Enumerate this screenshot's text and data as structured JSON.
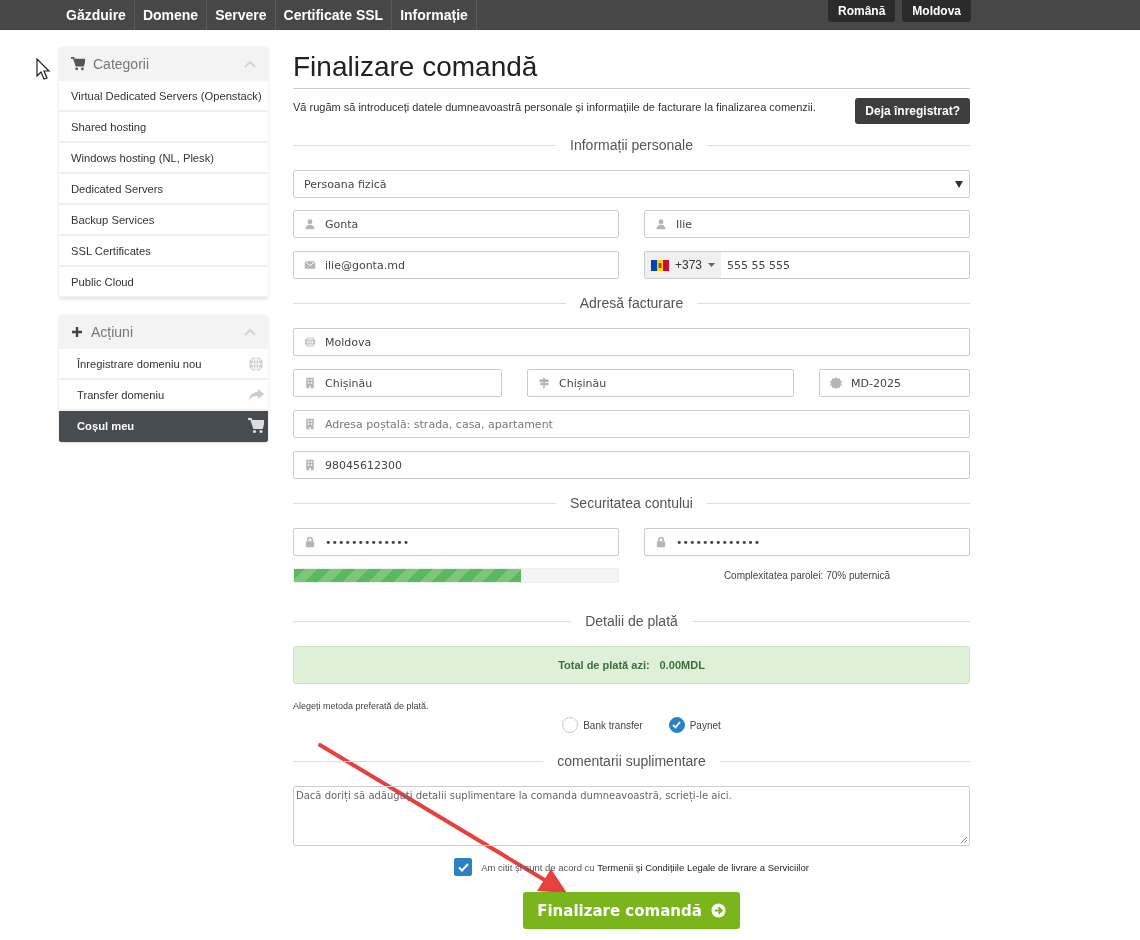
{
  "top_nav": {
    "links": [
      "Găzduire",
      "Domene",
      "Servere",
      "Certificate SSL",
      "Informație"
    ],
    "buttons": [
      "Română",
      "Moldova"
    ]
  },
  "sidebar": {
    "panels": [
      {
        "kind": "categories",
        "title": "Categorii",
        "expanded": true,
        "items": [
          {
            "label": "Virtual Dedicated Servers (Openstack)",
            "selected": false
          },
          {
            "label": "Shared hosting",
            "selected": false
          },
          {
            "label": "Windows hosting (NL, Plesk)",
            "selected": false
          },
          {
            "label": "Dedicated Servers",
            "selected": false
          },
          {
            "label": "Backup Services",
            "selected": false
          },
          {
            "label": "SSL Certificates",
            "selected": false
          },
          {
            "label": "Public Cloud",
            "selected": false
          }
        ]
      },
      {
        "kind": "actions",
        "title": "Acțiuni",
        "expanded": true,
        "items": [
          {
            "label": "Înregistrare domeniu nou",
            "kind": "globe",
            "selected": false
          },
          {
            "label": "Transfer domeniu",
            "kind": "share",
            "selected": false
          },
          {
            "label": "Coșul meu",
            "kind": "cart",
            "selected": true
          }
        ]
      }
    ]
  },
  "main": {
    "title": "Finalizare comandă",
    "intro": "Vă rugăm să introduceți datele dumneavoastră personale și informațiile de facturare la finalizarea comenzii.",
    "login_button": "Deja înregistrat?",
    "personal": {
      "heading": "Informații personale",
      "account_type": "Persoana fizică",
      "rows": [
        [
          {
            "kind": "user",
            "value": "Gonta"
          },
          {
            "kind": "user",
            "value": "Ilie"
          }
        ],
        [
          {
            "kind": "email",
            "value": "ilie@gonta.md"
          },
          {
            "kind": "phone",
            "code": "+373",
            "value": "555 55 555"
          }
        ]
      ]
    },
    "billing": {
      "heading": "Adresă facturare",
      "rows": [
        [
          {
            "kind": "globe",
            "value": "Moldova"
          }
        ],
        [
          {
            "kind": "building",
            "value": "Chișinău"
          },
          {
            "kind": "signpost",
            "value": "Chișinău"
          },
          {
            "kind": "seal",
            "value": "MD-2025"
          }
        ],
        [
          {
            "kind": "building",
            "placeholder": "Adresa poștală: strada, casa, apartament"
          }
        ],
        [
          {
            "kind": "office",
            "value": "98045612300"
          }
        ]
      ]
    },
    "security": {
      "heading": "Securitatea contului",
      "rows": [
        [
          {
            "kind": "lock",
            "value": "•••••••••••••"
          },
          {
            "kind": "lock",
            "value": "•••••••••••••"
          }
        ]
      ],
      "strength": {
        "level": 0.7,
        "label": "Complexitatea parolei: 70% puternică"
      }
    },
    "payment": {
      "heading": "Detalii de plată",
      "total_label": "Total de plată azi:",
      "total": "0.00MDL",
      "hint": "Alegeți metoda preferată de plată.",
      "methods": [
        {
          "label": "Bank transfer",
          "selected": false
        },
        {
          "label": "Paynet",
          "selected": true
        }
      ]
    },
    "comments": {
      "heading": "comentarii suplimentare",
      "placeholder": "Dacă doriți să adăugați detalii suplimentare la comanda dumneavoastră, scrieți-le aici."
    },
    "terms": {
      "checked": true,
      "text": "Am citit și sunt de acord cu",
      "link": "Termenii și Condițiile Legale de livrare a Serviciilor"
    },
    "submit": "Finalizare comandă"
  }
}
